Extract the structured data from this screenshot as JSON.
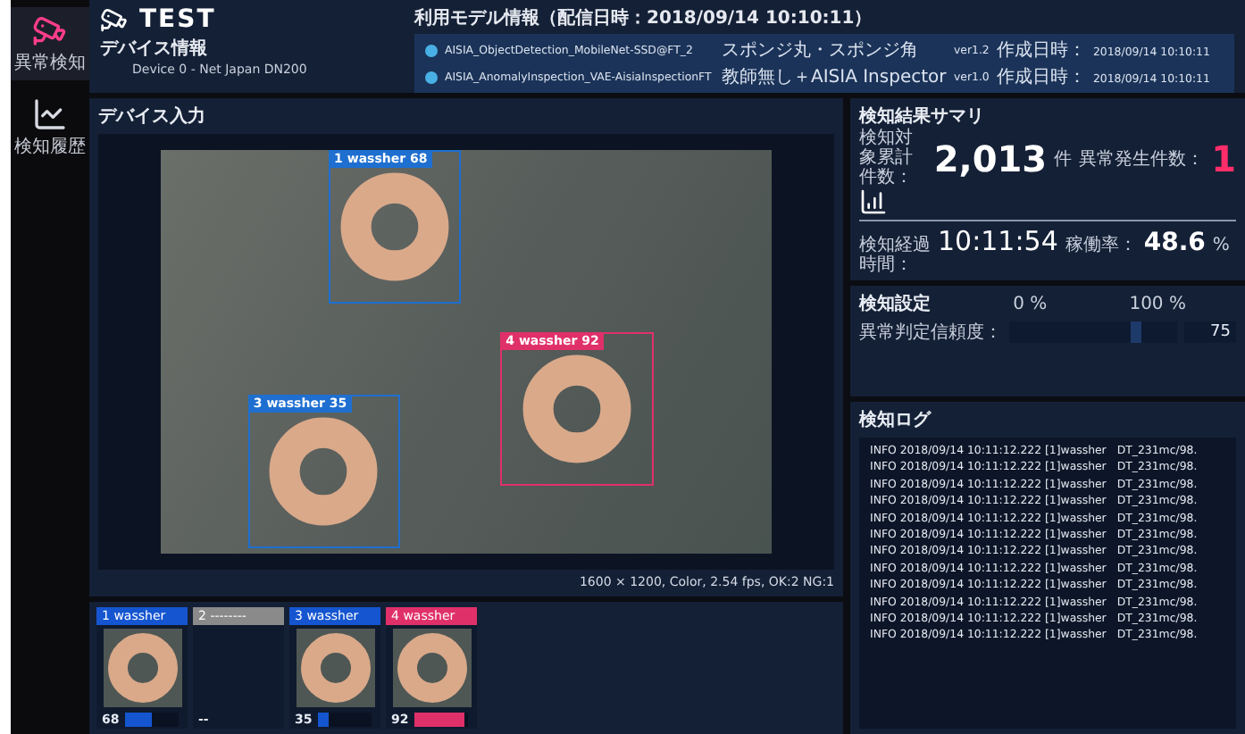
{
  "sidebar": {
    "items": [
      {
        "label": "異常検知",
        "selected": true
      },
      {
        "label": "検知履歴",
        "selected": false
      }
    ]
  },
  "header": {
    "title": "TEST",
    "device_label": "デバイス情報",
    "device": "Device 0 - Net Japan DN200"
  },
  "models": {
    "title": "利用モデル情報（配信日時：2018/09/14 10:10:11）",
    "rows": [
      {
        "name": "AISIA_ObjectDetection_MobileNet-SSD@FT_2",
        "category": "スポンジ丸・スポンジ角",
        "version": "ver1.2",
        "created_label": "作成日時：",
        "created": "2018/09/14 10:10:11"
      },
      {
        "name": "AISIA_AnomalyInspection_VAE-AisiaInspectionFT",
        "category": "教師無し＋AISIA Inspector",
        "version": "ver1.0",
        "created_label": "作成日時：",
        "created": "2018/09/14 10:10:11"
      }
    ]
  },
  "device_input": {
    "title": "デバイス入力",
    "detections": [
      {
        "index": "1",
        "label": "wassher",
        "score": "68",
        "color": "#1e6fd0"
      },
      {
        "index": "4",
        "label": "wassher",
        "score": "92",
        "color": "#e0306a"
      },
      {
        "index": "3",
        "label": "wassher",
        "score": "35",
        "color": "#1e6fd0"
      }
    ],
    "status": "1600 × 1200, Color, 2.54 fps, OK:2 NG:1"
  },
  "thumbnails": [
    {
      "kind": "detected",
      "index": "1",
      "label": "wassher",
      "score": "68",
      "level": 0.5,
      "color": "#1555d0"
    },
    {
      "kind": "empty",
      "index": "2",
      "label": "--------",
      "score": "--",
      "color": "#8a8a8a"
    },
    {
      "kind": "detected",
      "index": "3",
      "label": "wassher",
      "score": "35",
      "level": 0.2,
      "color": "#1555d0"
    },
    {
      "kind": "detected",
      "index": "4",
      "label": "wassher",
      "score": "92",
      "level": 0.95,
      "color": "#e0306a"
    }
  ],
  "summary": {
    "title": "検知結果サマリ",
    "total_label": "検知対象累計件数：",
    "total": "2,013",
    "total_unit": "件",
    "anomaly_label": "異常発生件数：",
    "anomaly": "1",
    "elapsed_label": "検知経過時間：",
    "elapsed": "10:11:54",
    "rate_label": "稼働率：",
    "rate": "48.6",
    "rate_unit": "%"
  },
  "settings": {
    "title": "検知設定",
    "min": "0 %",
    "max": "100 %",
    "threshold_label": "異常判定信頼度：",
    "level": 0.75,
    "reading": "75"
  },
  "log": {
    "title": "検知ログ",
    "lines": [
      {
        "text": "INFO 2018/09/14 10:11:12.222 [1]wassher",
        "detail": "DT_231mc/98."
      },
      {
        "text": "INFO 2018/09/14 10:11:12.222 [1]wassher",
        "detail": "DT_231mc/98."
      },
      {
        "text": "INFO 2018/09/14 10:11:12.222 [1]wassher",
        "detail": "DT_231mc/98."
      },
      {
        "text": "INFO 2018/09/14 10:11:12.222 [1]wassher",
        "detail": "DT_231mc/98."
      },
      {
        "text": "INFO 2018/09/14 10:11:12.222 [1]wassher",
        "detail": "DT_231mc/98."
      },
      {
        "text": "INFO 2018/09/14 10:11:12.222 [1]wassher",
        "detail": "DT_231mc/98."
      },
      {
        "text": "INFO 2018/09/14 10:11:12.222 [1]wassher",
        "detail": "DT_231mc/98."
      },
      {
        "text": "INFO 2018/09/14 10:11:12.222 [1]wassher",
        "detail": "DT_231mc/98."
      },
      {
        "text": "INFO 2018/09/14 10:11:12.222 [1]wassher",
        "detail": "DT_231mc/98."
      },
      {
        "text": "INFO 2018/09/14 10:11:12.222 [1]wassher",
        "detail": "DT_231mc/98."
      },
      {
        "text": "INFO 2018/09/14 10:11:12.222 [1]wassher",
        "detail": "DT_231mc/98."
      },
      {
        "text": "INFO 2018/09/14 10:11:12.222 [1]wassher",
        "detail": "DT_231mc/98."
      }
    ]
  }
}
